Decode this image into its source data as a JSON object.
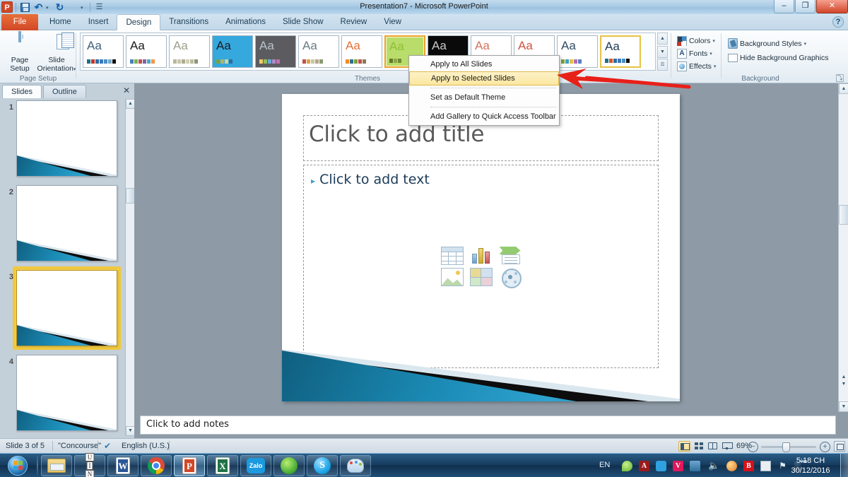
{
  "window": {
    "title": "Presentation7 - Microsoft PowerPoint",
    "minimize": "–",
    "maximize": "❐",
    "close": "✕",
    "help": "?"
  },
  "quick_access": {
    "app_logo": "P",
    "save_icon": "save-icon",
    "undo_icon": "undo-icon",
    "redo_icon": "redo-icon",
    "star_icon": "star-icon",
    "customize_icon": "customize-icon",
    "undo_glyph": "↶",
    "redo_glyph": "↻",
    "star_glyph": "☆",
    "caret_glyph": "▾",
    "bars_glyph": "☰"
  },
  "ribbon": {
    "file_tab": "File",
    "tabs": [
      {
        "label": "Home",
        "active": false
      },
      {
        "label": "Insert",
        "active": false
      },
      {
        "label": "Design",
        "active": true
      },
      {
        "label": "Transitions",
        "active": false
      },
      {
        "label": "Animations",
        "active": false
      },
      {
        "label": "Slide Show",
        "active": false
      },
      {
        "label": "Review",
        "active": false
      },
      {
        "label": "View",
        "active": false
      }
    ],
    "page_setup_group": {
      "label": "Page Setup",
      "page_setup_button": "Page\nSetup",
      "page_setup_line1": "Page",
      "page_setup_line2": "Setup",
      "slide_orientation_line1": "Slide",
      "slide_orientation_line2": "Orientation",
      "dropdown_caret": "▾"
    },
    "themes_group": {
      "label": "Themes",
      "sample_text": "Aa",
      "scroll_up": "▲",
      "scroll_down": "▼",
      "scroll_more": "☰",
      "thumbnails": [
        {
          "name": "theme-office",
          "aa_color": "#3f5f7a",
          "bg": "#ffffff",
          "swatches": [
            "#1f6f8b",
            "#c0392b",
            "#2e6da4",
            "#3a7abd",
            "#4a90c4",
            "#7aa8c9",
            "#111111"
          ],
          "state": "normal"
        },
        {
          "name": "theme-adjacency",
          "aa_color": "#1a1a1a",
          "bg": "#ffffff",
          "swatches": [
            "#4a7ebb",
            "#77b55a",
            "#c0504d",
            "#8064a2",
            "#4bacc6",
            "#f79646"
          ],
          "state": "normal"
        },
        {
          "name": "theme-angles",
          "aa_color": "#9aa08c",
          "bg": "#ffffff",
          "swatches": [
            "#b5b8a0",
            "#c9c6a8",
            "#a9ad92",
            "#d2cfb4",
            "#bdbc9e",
            "#8f9379"
          ],
          "state": "normal"
        },
        {
          "name": "theme-apex",
          "aa_color": "#1a1a1a",
          "bg": "#35a8dd",
          "swatches": [
            "#7aa33f",
            "#b0b36a",
            "#cfd49a",
            "#2b6f9e"
          ],
          "state": "normal"
        },
        {
          "name": "theme-apothecary",
          "aa_color": "#b9c3cc",
          "bg": "#5c5c60",
          "swatches": [
            "#f0c96a",
            "#8fbf5a",
            "#6aa8d8",
            "#a98ec9",
            "#c06fb0"
          ],
          "state": "normal"
        },
        {
          "name": "theme-aspect",
          "aa_color": "#6b7b86",
          "bg": "#ffffff",
          "swatches": [
            "#c0504d",
            "#d9a441",
            "#c8c8a2",
            "#b5a58a",
            "#8a9b6e"
          ],
          "state": "normal"
        },
        {
          "name": "theme-austin",
          "aa_color": "#e2703a",
          "bg": "#ffffff",
          "swatches": [
            "#f08a24",
            "#2f6f8f",
            "#7aa33f",
            "#c0504d",
            "#8a7a55"
          ],
          "state": "normal"
        },
        {
          "name": "theme-black-tie",
          "aa_color": "#8fbf3a",
          "bg": "#b9dd6a",
          "swatches": [
            "#5c7a2a",
            "#8fa845",
            "#6e8a33"
          ],
          "state": "hovered"
        },
        {
          "name": "theme-civic",
          "aa_color": "#c9c9c9",
          "bg": "#0a0a0a",
          "swatches": [
            "#d9d9d9",
            "#a8a8a8"
          ],
          "state": "normal"
        },
        {
          "name": "theme-clarity",
          "aa_color": "#d4755f",
          "bg": "#ffffff",
          "swatches": [
            "#c96f4f",
            "#8a9fb0"
          ],
          "state": "normal"
        },
        {
          "name": "theme-composite",
          "aa_color": "#d0523f",
          "bg": "#ffffff",
          "swatches": [
            "#c0392b",
            "#9b6a4a"
          ],
          "state": "normal"
        },
        {
          "name": "theme-concourse-alt",
          "aa_color": "#2f4a63",
          "bg": "#ffffff",
          "swatches": [
            "#7aa33f",
            "#3fa0c0",
            "#e0c04a",
            "#b06fb0",
            "#5b7fc4"
          ],
          "state": "normal"
        },
        {
          "name": "theme-concourse",
          "aa_color": "#1f3a55",
          "bg": "#ffffff",
          "swatches": [
            "#1f6f8b",
            "#d4552b",
            "#2e6da4",
            "#3a7abd",
            "#4a90c4",
            "#111111"
          ],
          "state": "selected"
        }
      ]
    },
    "background_group": {
      "label": "Background",
      "colors": "Colors",
      "fonts": "Fonts",
      "effects": "Effects",
      "background_styles": "Background Styles",
      "hide_background_graphics": "Hide Background Graphics",
      "fonts_glyph": "A",
      "dropdown_caret": "▾",
      "dialog_launcher": "⤵"
    }
  },
  "context_menu": {
    "items": [
      {
        "label": "Apply to All Slides",
        "highlighted": false
      },
      {
        "label": "Apply to Selected Slides",
        "highlighted": true
      },
      {
        "label": "Set as Default Theme",
        "highlighted": false
      },
      {
        "label": "Add Gallery to Quick Access Toolbar",
        "highlighted": false
      }
    ]
  },
  "slide_panel": {
    "tabs": [
      {
        "label": "Slides",
        "active": true
      },
      {
        "label": "Outline",
        "active": false
      }
    ],
    "close_glyph": "✕",
    "scroll_up": "▲",
    "scroll_down": "▼",
    "slides": [
      {
        "number": "1",
        "selected": false
      },
      {
        "number": "2",
        "selected": false
      },
      {
        "number": "3",
        "selected": true
      },
      {
        "number": "4",
        "selected": false
      }
    ]
  },
  "slide": {
    "title_placeholder": "Click to add title",
    "body_placeholder": "Click to add text",
    "bullet_glyph": "▸",
    "content_icons": [
      "insert-table-icon",
      "insert-chart-icon",
      "insert-smartart-icon",
      "insert-picture-icon",
      "insert-clipart-icon",
      "insert-media-clip-icon"
    ]
  },
  "notes": {
    "placeholder": "Click to add notes"
  },
  "status_bar": {
    "slide_counter": "Slide 3 of 5",
    "theme_name": "\"Concourse\"",
    "language": "English (U.S.)",
    "spellcheck_icon": "spellcheck-icon",
    "zoom_level": "69%",
    "zoom_out": "−",
    "zoom_in": "+",
    "views": [
      {
        "name": "view-normal",
        "active": true
      },
      {
        "name": "view-slide-sorter",
        "active": false
      },
      {
        "name": "view-reading",
        "active": false
      },
      {
        "name": "view-slide-show",
        "active": false
      }
    ],
    "fit_to_window": "fit-slide-to-window-icon"
  },
  "taskbar": {
    "start": "start-orb",
    "items": [
      {
        "name": "windows-explorer",
        "label": "Windows Explorer",
        "active": false
      },
      {
        "name": "unikey",
        "label": "UI N",
        "active": false
      },
      {
        "name": "microsoft-word",
        "label": "W",
        "active": false
      },
      {
        "name": "google-chrome",
        "label": "Chrome",
        "active": false
      },
      {
        "name": "microsoft-powerpoint",
        "label": "P",
        "active": true
      },
      {
        "name": "microsoft-excel",
        "label": "X",
        "active": false
      },
      {
        "name": "zalo",
        "label": "Zalo",
        "active": false
      },
      {
        "name": "green-app",
        "label": "App",
        "active": false
      },
      {
        "name": "skype",
        "label": "S",
        "active": false
      },
      {
        "name": "paint",
        "label": "Paint",
        "active": false
      }
    ],
    "tray": {
      "language": "EN",
      "icons": [
        "tray-green-icon",
        "adobe-reader-icon",
        "messenger-icon",
        "v-app-icon",
        "network-icon",
        "volume-icon",
        "antivirus-icon",
        "bkav-icon",
        "safely-remove-icon",
        "action-center-icon",
        "signal-icon"
      ],
      "time": "5:18 CH",
      "date": "30/12/2016"
    }
  },
  "annotation": {
    "type": "red-arrow",
    "color": "#e8201a",
    "points_to": "Apply to Selected Slides"
  }
}
